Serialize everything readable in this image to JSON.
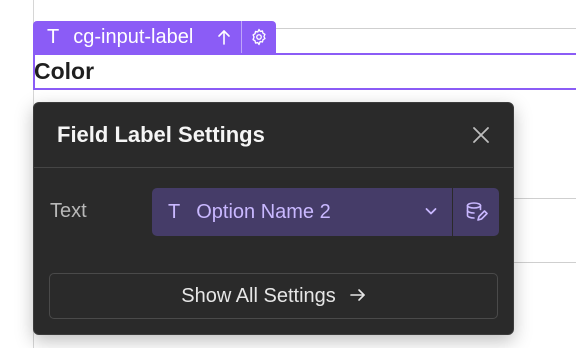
{
  "element_tag": {
    "type_icon": "T",
    "label": "cg-input-label",
    "icons": [
      "arrow-up-icon",
      "gear-icon"
    ]
  },
  "canvas": {
    "selected_text": "Color"
  },
  "panel": {
    "title": "Field Label Settings",
    "close_icon": "close-icon",
    "text_field": {
      "label": "Text",
      "type_icon": "T",
      "value": "Option Name 2",
      "dropdown_icon": "chevron-down-icon",
      "binding_icon": "database-edit-icon"
    },
    "show_all_label": "Show All Settings",
    "show_all_icon": "arrow-right-icon"
  },
  "colors": {
    "accent": "#8b5cf6",
    "panel_bg": "#2a2a2a",
    "binding_bg": "#453c68",
    "binding_text": "#c9b8ff"
  }
}
